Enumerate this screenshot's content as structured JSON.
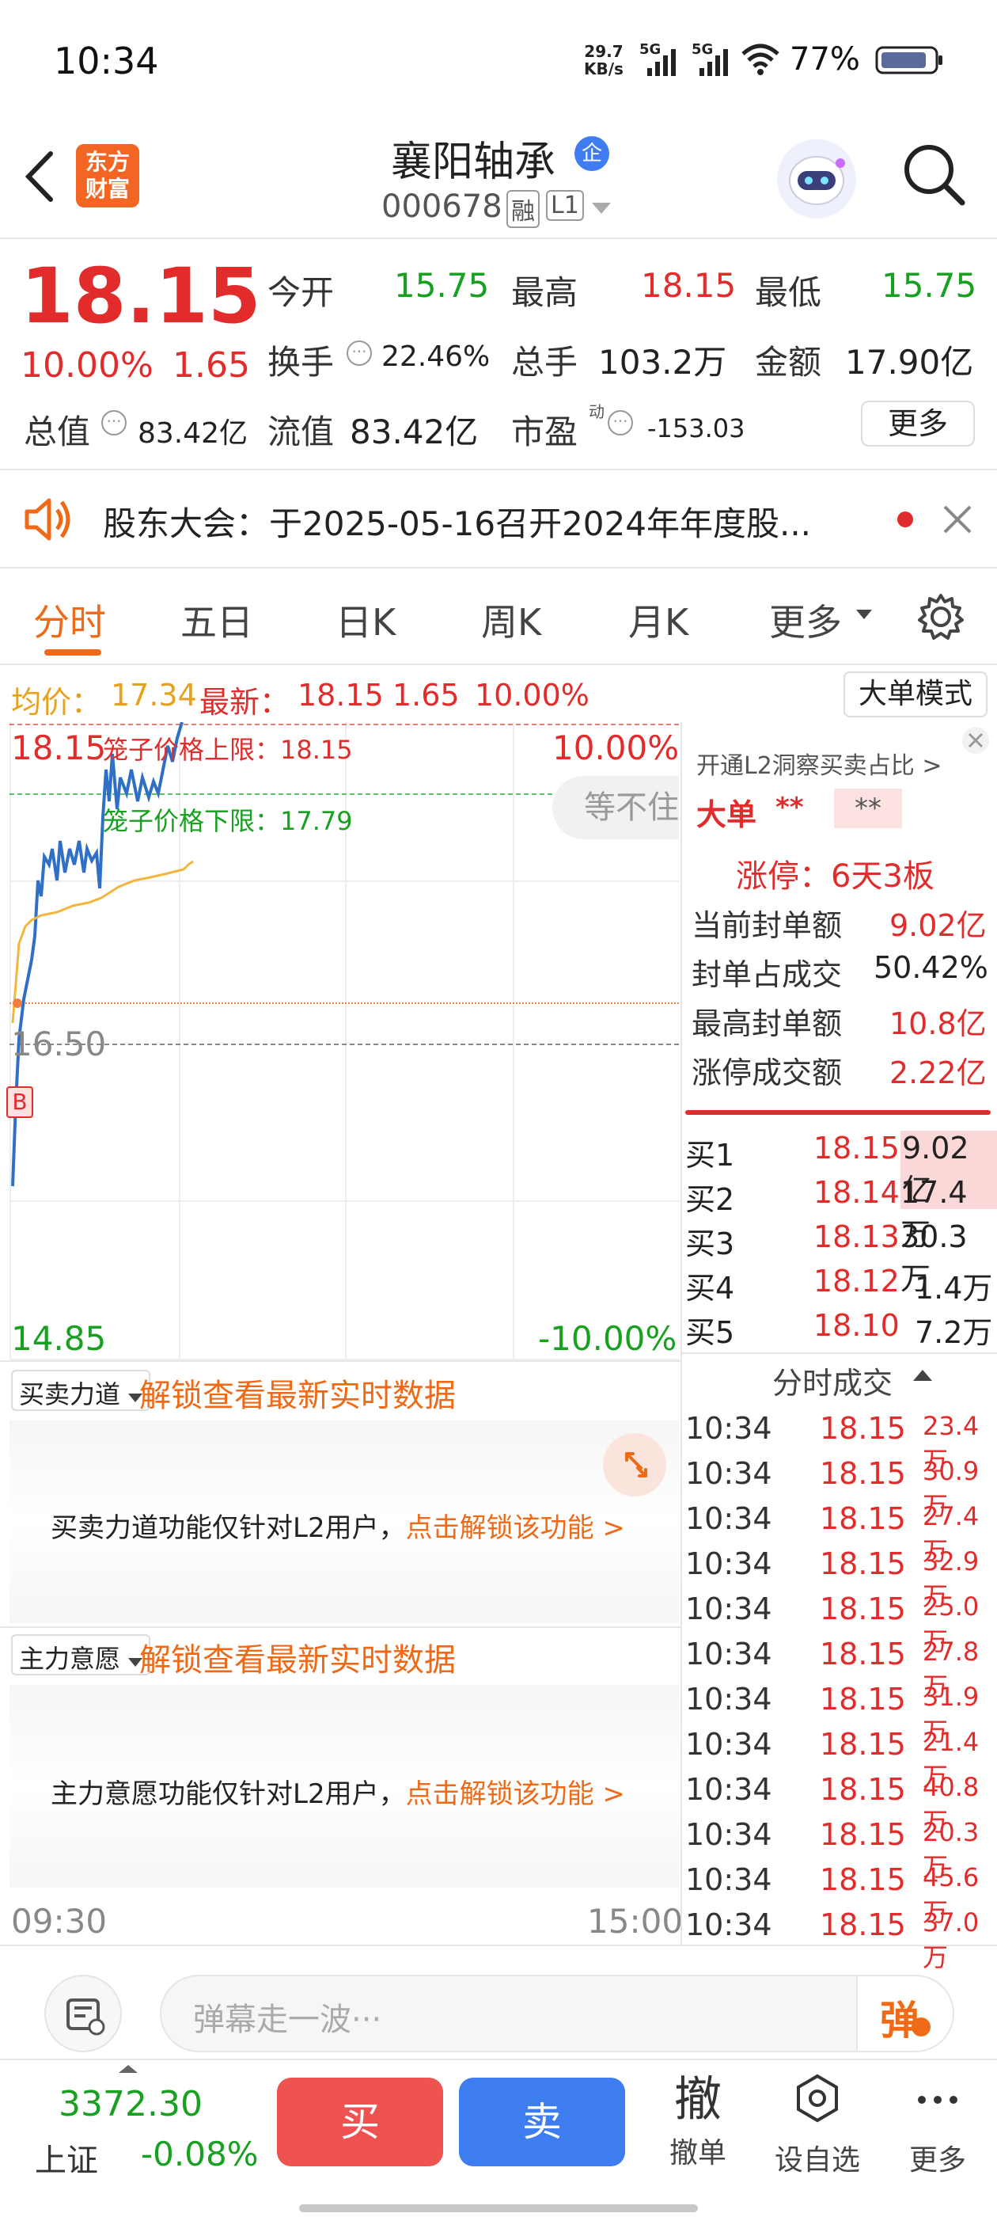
{
  "status_bar": {
    "time": "10:34",
    "net_speed_top": "29.7",
    "net_speed_unit": "KB/s",
    "sig1": "5G",
    "sig2": "5G",
    "battery": "77%"
  },
  "header": {
    "logo_line1": "东方",
    "logo_line2": "财富",
    "title": "襄阳轴承",
    "badge": "企",
    "code": "000678",
    "tag1": "融",
    "tag2": "L1"
  },
  "quote": {
    "price": "18.15",
    "change_pct": "10.00%",
    "change": "1.65",
    "open_label": "今开",
    "open": "15.75",
    "high_label": "最高",
    "high": "18.15",
    "low_label": "最低",
    "low": "15.75",
    "turnover_label": "换手",
    "turnover": "22.46%",
    "volume_label": "总手",
    "volume": "103.2万",
    "amount_label": "金额",
    "amount": "17.90亿",
    "mcap_label": "总值",
    "mcap": "83.42亿",
    "float_label": "流值",
    "float_cap": "83.42亿",
    "pe_label": "市盈",
    "pe_sup": "动",
    "pe": "-153.03",
    "more": "更多"
  },
  "notice": {
    "text": "股东大会：于2025-05-16召开2024年年度股..."
  },
  "tabs": [
    "分时",
    "五日",
    "日K",
    "周K",
    "月K",
    "更多"
  ],
  "chart_bar": {
    "avg_label": "均价：",
    "avg": "17.34",
    "latest_label": "最新：",
    "latest": "18.15",
    "chg": "1.65",
    "chg_pct": "10.00%",
    "mode_button": "大单模式"
  },
  "chart": {
    "y_top": "18.15",
    "y_top_pct": "10.00%",
    "cage_upper": "笼子价格上限：18.15",
    "cage_lower": "笼子价格下限：17.79",
    "mid": "16.50",
    "y_bottom": "14.85",
    "y_bottom_pct": "-10.00%",
    "marker": "B",
    "tooltip": "等不住",
    "t_start": "09:30",
    "t_end": "15:00"
  },
  "panel1": {
    "select": "买卖力道",
    "unlock": "解锁查看最新实时数据",
    "msg": "买卖力道功能仅针对L2用户，",
    "link": "点击解锁该功能 >"
  },
  "panel2": {
    "select": "主力意愿",
    "unlock": "解锁查看最新实时数据",
    "msg": "主力意愿功能仅针对L2用户，",
    "link": "点击解锁该功能 >"
  },
  "right_panel": {
    "l2_link": "开通L2洞察买卖占比 >",
    "big_label": "大单",
    "big_val1": "**",
    "big_val2": "**",
    "limit_title": "涨停：6天3板",
    "stats": [
      {
        "label": "当前封单额",
        "value": "9.02亿"
      },
      {
        "label": "封单占成交",
        "value": "50.42%"
      },
      {
        "label": "最高封单额",
        "value": "10.8亿"
      },
      {
        "label": "涨停成交额",
        "value": "2.22亿"
      }
    ],
    "orderbook": [
      {
        "label": "买1",
        "price": "18.15",
        "vol": "9.02亿"
      },
      {
        "label": "买2",
        "price": "18.14",
        "vol": "17.4万"
      },
      {
        "label": "买3",
        "price": "18.13",
        "vol": "30.3万"
      },
      {
        "label": "买4",
        "price": "18.12",
        "vol": "1.4万"
      },
      {
        "label": "买5",
        "price": "18.10",
        "vol": "7.2万"
      }
    ],
    "trades_title": "分时成交",
    "trades": [
      {
        "time": "10:34",
        "price": "18.15",
        "vol": "23.4万"
      },
      {
        "time": "10:34",
        "price": "18.15",
        "vol": "30.9万"
      },
      {
        "time": "10:34",
        "price": "18.15",
        "vol": "27.4万"
      },
      {
        "time": "10:34",
        "price": "18.15",
        "vol": "32.9万"
      },
      {
        "time": "10:34",
        "price": "18.15",
        "vol": "25.0万"
      },
      {
        "time": "10:34",
        "price": "18.15",
        "vol": "27.8万"
      },
      {
        "time": "10:34",
        "price": "18.15",
        "vol": "31.9万"
      },
      {
        "time": "10:34",
        "price": "18.15",
        "vol": "21.4万"
      },
      {
        "time": "10:34",
        "price": "18.15",
        "vol": "40.8万"
      },
      {
        "time": "10:34",
        "price": "18.15",
        "vol": "20.3万"
      },
      {
        "time": "10:34",
        "price": "18.15",
        "vol": "45.6万"
      },
      {
        "time": "10:34",
        "price": "18.15",
        "vol": "37.0万"
      }
    ]
  },
  "comment": {
    "placeholder": "弹幕走一波···",
    "danmu": "弹"
  },
  "bottom": {
    "index_value": "3372.30",
    "index_name": "上证",
    "index_chg": "-0.08%",
    "buy": "买",
    "sell": "卖",
    "cancel_glyph": "撤",
    "cancel": "撤单",
    "watch": "设自选",
    "more": "更多"
  },
  "colors": {
    "up": "#e22c2c",
    "down": "#18a020",
    "accent": "#ee6a16",
    "buy_btn": "#ef5350",
    "sell_btn": "#3d7df0",
    "price_line": "#2f6fc5",
    "avg_line": "#f2b640"
  }
}
